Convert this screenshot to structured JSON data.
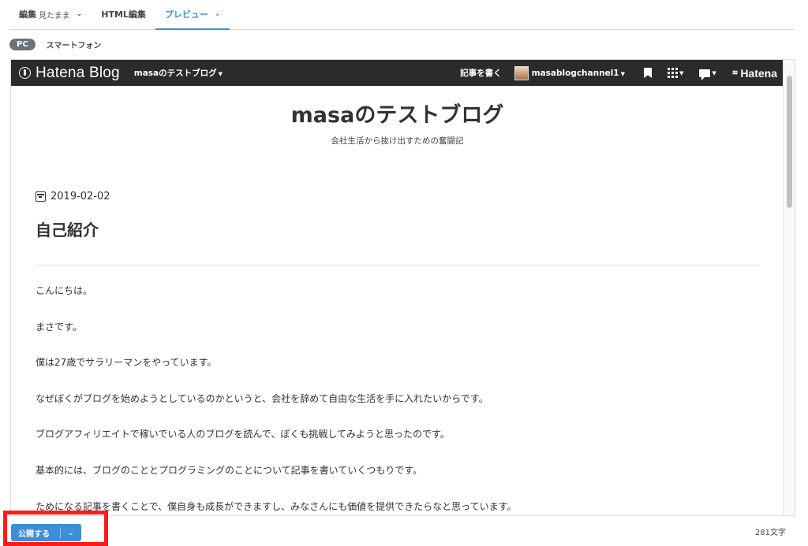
{
  "editor_tabs": [
    {
      "label": "編集",
      "sub": "見たまま",
      "chevron": "⌄"
    },
    {
      "label": "HTML編集"
    },
    {
      "label": "プレビュー",
      "chevron": "⌄"
    }
  ],
  "device": {
    "pc": "PC",
    "smartphone": "スマートフォン"
  },
  "topbar": {
    "logo": "Hatena Blog",
    "blog_name": "masaのテストブログ",
    "write": "記事を書く",
    "user": "masablogchannel1",
    "hatena": "Hatena"
  },
  "blog": {
    "title": "masaのテストブログ",
    "description": "会社生活から抜け出すための奮闘記"
  },
  "entry": {
    "date": "2019-02-02",
    "title": "自己紹介",
    "paragraphs": [
      "こんにちは。",
      "まさです。",
      "僕は27歳でサラリーマンをやっています。",
      "なぜぼくがブログを始めようとしているのかというと、会社を辞めて自由な生活を手に入れたいからです。",
      "ブログアフィリエイトで稼いでいる人のブログを読んで、ぼくも挑戦してみようと思ったのです。",
      "基本的には、ブログのこととプログラミングのことについて記事を書いていくつもりです。",
      "ためになる記事を書くことで、僕自身も成長ができますし、みなさんにも価値を提供できたらなと思っています。"
    ]
  },
  "footer": {
    "publish": "公開する",
    "dropdown": "⌄",
    "char_count": "281文字"
  },
  "colors": {
    "accent": "#3d8fd9",
    "highlight": "#ff1a1a",
    "topbar": "#2b2b2b"
  }
}
